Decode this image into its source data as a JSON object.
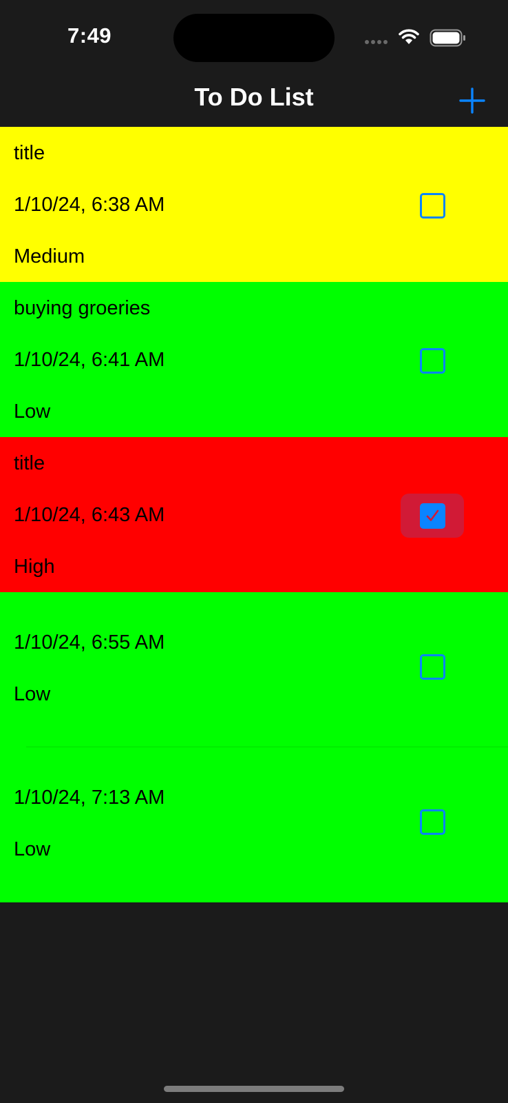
{
  "status_bar": {
    "time": "7:49",
    "icons": [
      "cellular-signal-icon",
      "wifi-icon",
      "battery-icon"
    ]
  },
  "nav": {
    "title": "To Do List",
    "add_icon": "plus-icon",
    "accent_color": "#0a84ff"
  },
  "colors": {
    "background": "#1b1b1b",
    "priority_high": "#ff0000",
    "priority_medium": "#ffff00",
    "priority_low": "#00ff00"
  },
  "todos": [
    {
      "title": "title",
      "date": "1/10/24, 6:38 AM",
      "priority": "Medium",
      "color": "#ffff00",
      "checked": false,
      "selected": false
    },
    {
      "title": "buying groeries",
      "date": "1/10/24, 6:41 AM",
      "priority": "Low",
      "color": "#00ff00",
      "checked": false,
      "selected": false
    },
    {
      "title": "title",
      "date": "1/10/24, 6:43 AM",
      "priority": "High",
      "color": "#ff0000",
      "checked": true,
      "selected": true
    },
    {
      "title": "",
      "date": "1/10/24, 6:55 AM",
      "priority": "Low",
      "color": "#00ff00",
      "checked": false,
      "selected": false
    },
    {
      "title": "",
      "date": "1/10/24, 7:13 AM",
      "priority": "Low",
      "color": "#00ff00",
      "checked": false,
      "selected": false
    }
  ]
}
